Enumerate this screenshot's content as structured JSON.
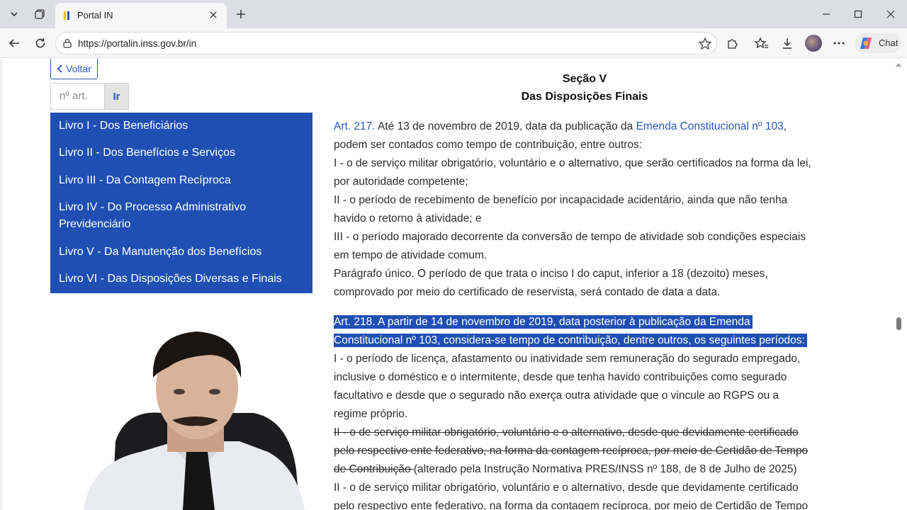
{
  "browser": {
    "tab_title": "Portal IN",
    "url": "https://portalin.inss.gov.br/in",
    "chat_label": "Chat"
  },
  "sidebar": {
    "back_label": "Voltar",
    "article_placeholder": "nº art.",
    "go_label": "Ir",
    "books": [
      "Livro I - Dos Beneficiários",
      "Livro II - Dos Benefícios e Serviços",
      "Livro III - Da Contagem Recíproca",
      "Livro IV - Do Processo Administrativo",
      "Previdenciário",
      "Livro V - Da Manutenção dos Benefícios",
      "Livro VI - Das Disposições Diversas e Finais"
    ]
  },
  "section": {
    "title": "Seção V",
    "subtitle": "Das Disposições Finais"
  },
  "art217": {
    "label": "Art. 217.",
    "text1": " Até 13 de novembro de 2019, data da publicação da ",
    "link": "Emenda Constitucional nº 103",
    "text2": ",",
    "lines": [
      "podem ser contados como tempo de contribuição, entre outros:",
      "I - o de serviço militar obrigatório, voluntário e o alternativo, que serão certificados na forma da lei,",
      "por autoridade competente;",
      "II - o período de recebimento de benefício por incapacidade acidentário, ainda que não tenha",
      "havido o retorno à atividade; e",
      "III - o período majorado decorrente da conversão de tempo de atividade sob condições especiais",
      "em tempo de atividade comum.",
      "Parágrafo único. O período de que trata o inciso I do caput, inferior a 18 (dezoito) meses,",
      "comprovado por meio do certificado de reservista, será contado de data a data."
    ]
  },
  "art218": {
    "highlight": [
      "Art. 218. A partir de 14 de novembro de 2019, data posterior à publicação da Emenda",
      "Constitucional nº 103, considera-se tempo de contribuição, dentre outros, os seguintes períodos:"
    ],
    "lines": [
      "I - o período de licença, afastamento ou inatividade sem remuneração do segurado empregado,",
      "inclusive o doméstico e o intermitente, desde que tenha havido contribuições como segurado",
      "facultativo e desde que o segurado não exerça outra atividade que o vincule ao RGPS ou a",
      "regime próprio."
    ],
    "struck": [
      "II - o de serviço militar obrigatório, voluntário e o alternativo, desde que devidamente certificado",
      "pelo respectivo ente federativo, na forma da contagem recíproca, por meio de Certidão de Tempo",
      "de Contribuição "
    ],
    "amend_note": "(alterado pela Instrução Normativa PRES/INSS nº 188, de 8 de Julho de 2025)",
    "after": [
      "II - o de serviço militar obrigatório, voluntário e o alternativo, desde que devidamente certificado",
      "pelo respectivo ente federativo, na forma da contagem recíproca, por meio de Certidão de Tempo"
    ]
  }
}
